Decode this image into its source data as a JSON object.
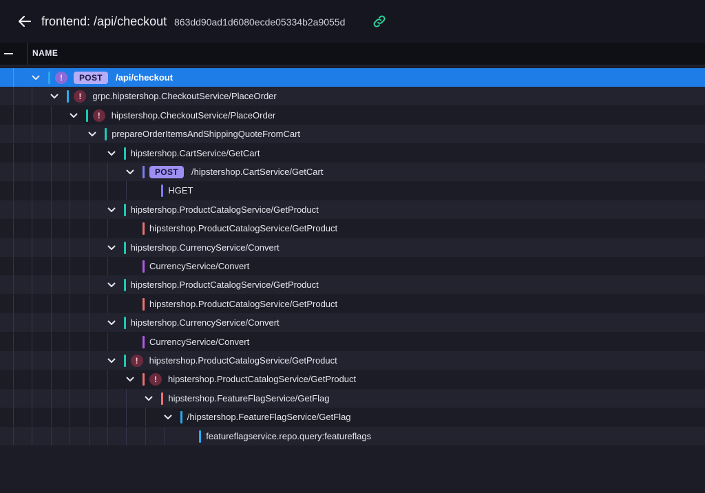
{
  "header": {
    "title": "frontend: /api/checkout",
    "trace_id": "863dd90ad1d6080ecde05334b2a9055d",
    "back_icon": "arrow-left-icon",
    "link_icon": "link-icon"
  },
  "column_header": {
    "name": "NAME"
  },
  "colors": {
    "teal": "#1fc8b4",
    "blue": "#2aa9ee",
    "indigo": "#7c7cf6",
    "red": "#f07070",
    "purple": "#b557e8",
    "selected": "#1f7de8",
    "badge": "#9d8ff2"
  },
  "spans": [
    {
      "depth": 0,
      "expanded": true,
      "error": true,
      "method": "POST",
      "label": "/api/checkout",
      "color": "#2aa9ee",
      "selected": true
    },
    {
      "depth": 1,
      "expanded": true,
      "error": true,
      "method": "",
      "label": "grpc.hipstershop.CheckoutService/PlaceOrder",
      "color": "#2aa9ee"
    },
    {
      "depth": 2,
      "expanded": true,
      "error": true,
      "method": "",
      "label": "hipstershop.CheckoutService/PlaceOrder",
      "color": "#1fc8b4"
    },
    {
      "depth": 3,
      "expanded": true,
      "error": false,
      "method": "",
      "label": "prepareOrderItemsAndShippingQuoteFromCart",
      "color": "#1fc8b4"
    },
    {
      "depth": 4,
      "expanded": true,
      "error": false,
      "method": "",
      "label": "hipstershop.CartService/GetCart",
      "color": "#1fc8b4"
    },
    {
      "depth": 5,
      "expanded": true,
      "error": false,
      "method": "POST",
      "label": "/hipstershop.CartService/GetCart",
      "color": "#7c7cf6"
    },
    {
      "depth": 6,
      "expanded": null,
      "error": false,
      "method": "",
      "label": "HGET",
      "color": "#7c7cf6"
    },
    {
      "depth": 4,
      "expanded": true,
      "error": false,
      "method": "",
      "label": "hipstershop.ProductCatalogService/GetProduct",
      "color": "#1fc8b4"
    },
    {
      "depth": 5,
      "expanded": null,
      "error": false,
      "method": "",
      "label": "hipstershop.ProductCatalogService/GetProduct",
      "color": "#f07070"
    },
    {
      "depth": 4,
      "expanded": true,
      "error": false,
      "method": "",
      "label": "hipstershop.CurrencyService/Convert",
      "color": "#1fc8b4"
    },
    {
      "depth": 5,
      "expanded": null,
      "error": false,
      "method": "",
      "label": "CurrencyService/Convert",
      "color": "#b557e8"
    },
    {
      "depth": 4,
      "expanded": true,
      "error": false,
      "method": "",
      "label": "hipstershop.ProductCatalogService/GetProduct",
      "color": "#1fc8b4"
    },
    {
      "depth": 5,
      "expanded": null,
      "error": false,
      "method": "",
      "label": "hipstershop.ProductCatalogService/GetProduct",
      "color": "#f07070"
    },
    {
      "depth": 4,
      "expanded": true,
      "error": false,
      "method": "",
      "label": "hipstershop.CurrencyService/Convert",
      "color": "#1fc8b4"
    },
    {
      "depth": 5,
      "expanded": null,
      "error": false,
      "method": "",
      "label": "CurrencyService/Convert",
      "color": "#b557e8"
    },
    {
      "depth": 4,
      "expanded": true,
      "error": true,
      "method": "",
      "label": "hipstershop.ProductCatalogService/GetProduct",
      "color": "#1fc8b4"
    },
    {
      "depth": 5,
      "expanded": true,
      "error": true,
      "method": "",
      "label": "hipstershop.ProductCatalogService/GetProduct",
      "color": "#f07070"
    },
    {
      "depth": 6,
      "expanded": true,
      "error": false,
      "method": "",
      "label": "hipstershop.FeatureFlagService/GetFlag",
      "color": "#f07070"
    },
    {
      "depth": 7,
      "expanded": true,
      "error": false,
      "method": "",
      "label": "/hipstershop.FeatureFlagService/GetFlag",
      "color": "#2aa9ee"
    },
    {
      "depth": 8,
      "expanded": null,
      "error": false,
      "method": "",
      "label": "featureflagservice.repo.query:featureflags",
      "color": "#2aa9ee"
    }
  ]
}
